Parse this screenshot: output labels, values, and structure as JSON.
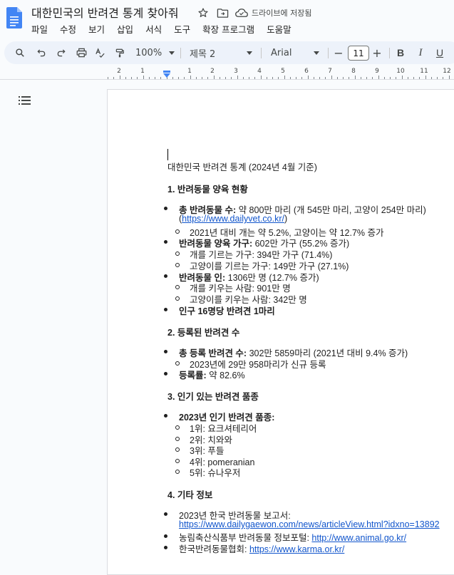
{
  "app": {
    "doc_title": "대한민국의 반려견 통계 찾아줘",
    "save_status": "드라이브에 저장됨",
    "accent_color": "#4285f4"
  },
  "menu": [
    "파일",
    "수정",
    "보기",
    "삽입",
    "서식",
    "도구",
    "확장 프로그램",
    "도움말"
  ],
  "toolbar": {
    "zoom": "100%",
    "style": "제목 2",
    "font": "Arial",
    "font_size": "11",
    "bold": "B",
    "italic": "I",
    "underline": "U",
    "minus": "−",
    "plus": "+"
  },
  "ruler": [
    "2",
    "1",
    "1",
    "2",
    "3",
    "4",
    "5",
    "6",
    "7",
    "8",
    "9",
    "10",
    "11",
    "12"
  ],
  "document": {
    "heading": "대한민국 반려견 통계 (2024년 4월 기준)",
    "s1_title": "1. 반려동물 양육 현황",
    "s1_b1_label": "총 반려동물 수:",
    "s1_b1_text": " 약 800만 마리 (개 545만 마리, 고양이 254만 마리)",
    "s1_b1_link": "https://www.dailyvet.co.kr/",
    "s1_b1_sub1": "2021년 대비 개는 약 5.2%, 고양이는 약 12.7% 증가",
    "s1_b2_label": "반려동물 양육 가구:",
    "s1_b2_text": " 602만 가구 (55.2% 증가)",
    "s1_b2_sub1": "개를 기르는 가구: 394만 가구 (71.4%)",
    "s1_b2_sub2": "고양이를 기르는 가구: 149만 가구 (27.1%)",
    "s1_b3_label": "반려동물 인:",
    "s1_b3_text": " 1306만 명 (12.7% 증가)",
    "s1_b3_sub1": "개를 키우는 사람: 901만 명",
    "s1_b3_sub2": "고양이를 키우는 사람: 342만 명",
    "s1_b4": "인구 16명당 반려견 1마리",
    "s2_title": "2. 등록된 반려견 수",
    "s2_b1_label": "총 등록 반려견 수:",
    "s2_b1_text": " 302만 5859마리 (2021년 대비 9.4% 증가)",
    "s2_b1_sub1": "2023년에 29만 958마리가 신규 등록",
    "s2_b2_label": "등록률:",
    "s2_b2_text": " 약 82.6%",
    "s3_title": "3. 인기 있는 반려견 품종",
    "s3_b1": "2023년 인기 반려견 품종:",
    "s3_ranks": [
      "1위: 요크셔테리어",
      "2위: 치와와",
      "3위: 푸들",
      "4위: pomeranian",
      "5위: 슈나우저"
    ],
    "s4_title": "4. 기타 정보",
    "s4_b1_text": "2023년 한국 반려동물 보고서:",
    "s4_b1_link": "https://www.dailygaewon.com/news/articleView.html?idxno=13892",
    "s4_b2_text": "농림축산식품부 반려동물 정보포털: ",
    "s4_b2_link": "http://www.animal.go.kr/",
    "s4_b3_text": "한국반려동물협회: ",
    "s4_b3_link": "https://www.karma.or.kr/"
  }
}
